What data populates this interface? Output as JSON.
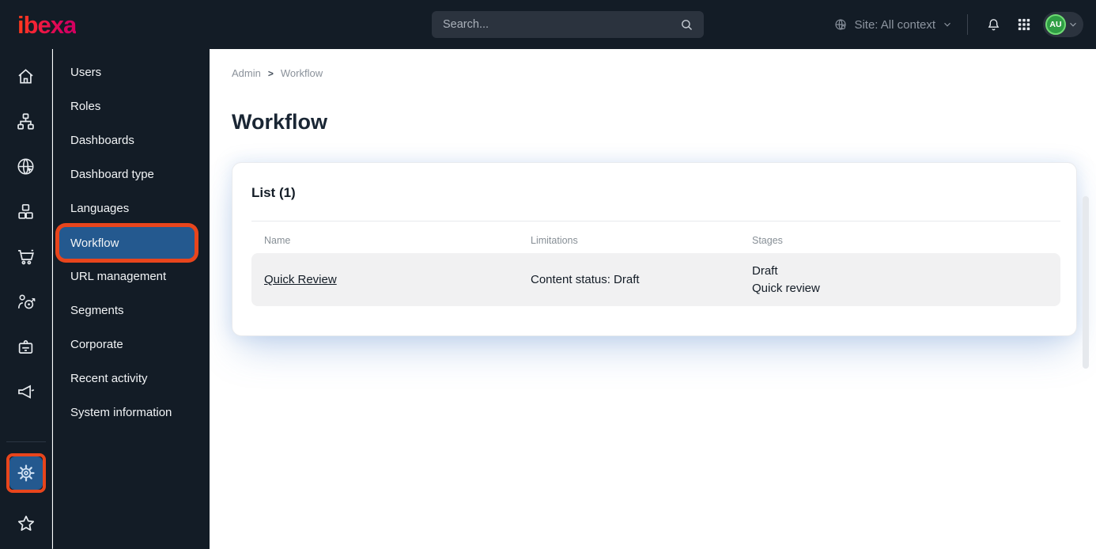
{
  "topbar": {
    "logo": "ibexa",
    "search_placeholder": "Search...",
    "site_label": "Site: All context",
    "avatar_initials": "AU",
    "icons": [
      "search-icon",
      "globe-icon",
      "chevron-down-icon",
      "bell-icon",
      "app-grid-icon"
    ]
  },
  "rail": {
    "icons": [
      "home-icon",
      "content-tree-icon",
      "site-globe-icon",
      "product-blocks-icon",
      "cart-icon",
      "personalization-target-icon",
      "id-badge-icon",
      "megaphone-icon",
      "settings-gear-icon",
      "bookmarks-star-icon"
    ],
    "active_item": "settings-gear"
  },
  "sidebar": {
    "items": [
      {
        "label": "Users",
        "active": false
      },
      {
        "label": "Roles",
        "active": false
      },
      {
        "label": "Dashboards",
        "active": false
      },
      {
        "label": "Dashboard type",
        "active": false
      },
      {
        "label": "Languages",
        "active": false
      },
      {
        "label": "Workflow",
        "active": true
      },
      {
        "label": "URL management",
        "active": false
      },
      {
        "label": "Segments",
        "active": false
      },
      {
        "label": "Corporate",
        "active": false
      },
      {
        "label": "Recent activity",
        "active": false
      },
      {
        "label": "System information",
        "active": false
      }
    ]
  },
  "breadcrumb": {
    "items": [
      "Admin",
      "Workflow"
    ],
    "separator": ">"
  },
  "page": {
    "title": "Workflow"
  },
  "card": {
    "title": "List (1)",
    "table": {
      "columns": [
        "Name",
        "Limitations",
        "Stages"
      ],
      "rows": [
        {
          "name": "Quick Review",
          "limitations": "Content status: Draft",
          "stages": [
            "Draft",
            "Quick review"
          ]
        }
      ]
    }
  },
  "colors": {
    "topbar_dark": "#131c26",
    "active_blue": "#24598f",
    "annotation_orange": "#e8451c",
    "avatar_green": "#2f9e44",
    "logo_gradient_start": "#ff3a1c",
    "logo_gradient_end": "#d4005f",
    "row_gray": "#f1f1f2"
  }
}
